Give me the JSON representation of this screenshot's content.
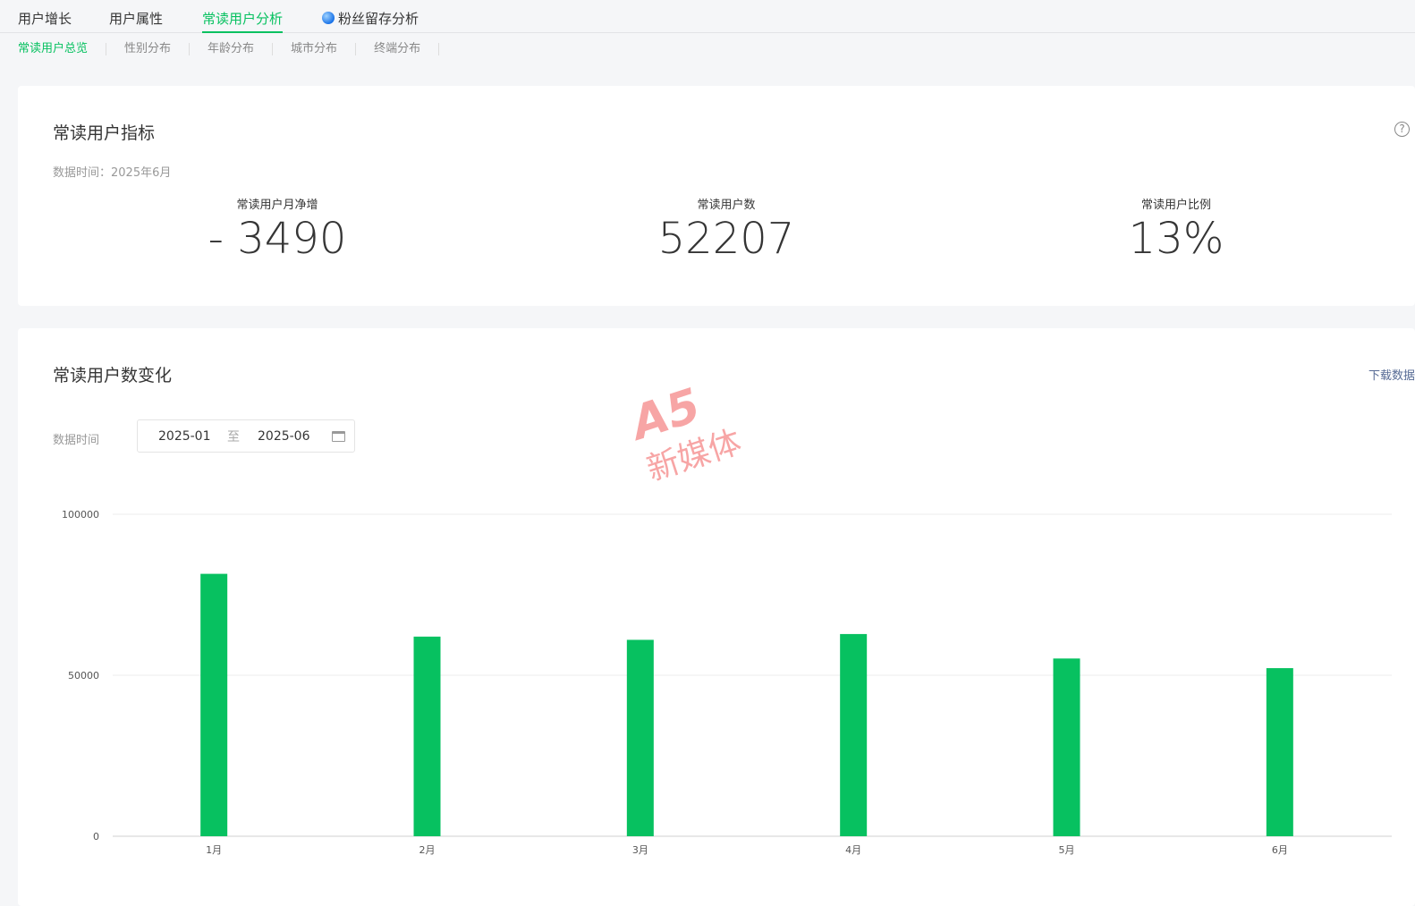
{
  "tabs": [
    {
      "label": "用户增长"
    },
    {
      "label": "用户属性"
    },
    {
      "label": "常读用户分析"
    },
    {
      "label": "粉丝留存分析"
    }
  ],
  "subtabs": [
    {
      "label": "常读用户总览"
    },
    {
      "label": "性别分布"
    },
    {
      "label": "年龄分布"
    },
    {
      "label": "城市分布"
    },
    {
      "label": "终端分布"
    }
  ],
  "metrics_card": {
    "title": "常读用户指标",
    "help": "?",
    "data_time": "数据时间：2025年6月",
    "items": [
      {
        "label": "常读用户月净增",
        "value": "- 3490"
      },
      {
        "label": "常读用户数",
        "value": "52207"
      },
      {
        "label": "常读用户比例",
        "value": "13%"
      }
    ]
  },
  "chart_card": {
    "title": "常读用户数变化",
    "download": "下载数据",
    "filter_label": "数据时间",
    "date_from": "2025-01",
    "date_sep": "至",
    "date_to": "2025-06"
  },
  "watermark": {
    "logo": "A5",
    "text": "新媒体"
  },
  "colors": {
    "accent": "#07c160",
    "link": "#576b95"
  },
  "chart_data": {
    "type": "bar",
    "categories": [
      "1月",
      "2月",
      "3月",
      "4月",
      "5月",
      "6月"
    ],
    "values": [
      81500,
      62000,
      61000,
      62800,
      55200,
      52207
    ],
    "ylim": [
      0,
      100000
    ],
    "yticks": [
      "0",
      "50000",
      "100000"
    ],
    "grid": true,
    "color": "#07c160"
  }
}
